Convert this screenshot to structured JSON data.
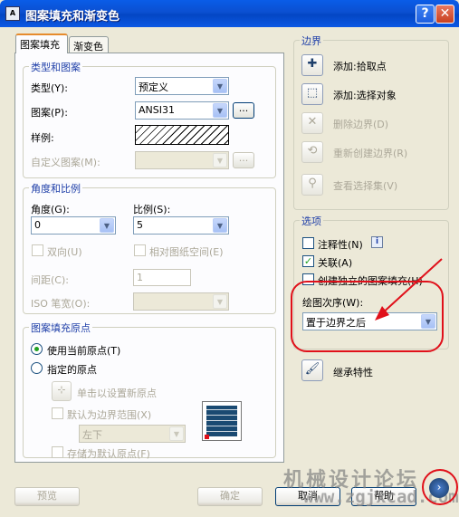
{
  "window": {
    "title": "图案填充和渐变色",
    "app_icon": "acad-icon",
    "help_button": "?",
    "close_button": "✕"
  },
  "tabs": [
    {
      "label": "图案填充",
      "active": true
    },
    {
      "label": "渐变色",
      "active": false
    }
  ],
  "type_pattern": {
    "group_label": "类型和图案",
    "type_label": "类型(Y):",
    "type_value": "预定义",
    "pattern_label": "图案(P):",
    "pattern_value": "ANSI31",
    "pattern_browse": "...",
    "sample_label": "样例:",
    "custom_label": "自定义图案(M):",
    "custom_value": "",
    "custom_browse": "..."
  },
  "angle_scale": {
    "group_label": "角度和比例",
    "angle_label": "角度(G):",
    "angle_value": "0",
    "scale_label": "比例(S):",
    "scale_value": "5",
    "double_label": "双向(U)",
    "relative_label": "相对图纸空间(E)",
    "spacing_label": "间距(C):",
    "spacing_value": "1",
    "iso_label": "ISO 笔宽(O):",
    "iso_value": ""
  },
  "origin": {
    "group_label": "图案填充原点",
    "current_origin_label": "使用当前原点(T)",
    "current_origin_selected": true,
    "specified_origin_label": "指定的原点",
    "specified_origin_selected": false,
    "click_set_label": "单击以设置新原点",
    "default_extent_label": "默认为边界范围(X)",
    "extent_value": "左下",
    "store_default_label": "存储为默认原点(F)"
  },
  "boundaries": {
    "group_label": "边界",
    "add_pick": "添加:拾取点",
    "add_select": "添加:选择对象",
    "remove": "删除边界(D)",
    "recreate": "重新创建边界(R)",
    "view_selection": "查看选择集(V)"
  },
  "options": {
    "group_label": "选项",
    "annotative_label": "注释性(N)",
    "annotative_checked": false,
    "associative_label": "关联(A)",
    "associative_checked": true,
    "separate_label": "创建独立的图案填充(H)",
    "separate_checked": false,
    "draw_order_label": "绘图次序(W):",
    "draw_order_value": "置于边界之后"
  },
  "inherit_label": "继承特性",
  "buttons": {
    "preview": "预览",
    "ok": "确定",
    "cancel": "取消",
    "help": "帮助",
    "more": "›"
  },
  "watermark": {
    "line1": "机械设计论坛",
    "line2": "www.zgjxcad.com"
  },
  "colors": {
    "titlebar": "#0b4fd0",
    "group_label": "#1f3fa8",
    "annotation_red": "#e0101a",
    "check_green": "#21a121"
  }
}
